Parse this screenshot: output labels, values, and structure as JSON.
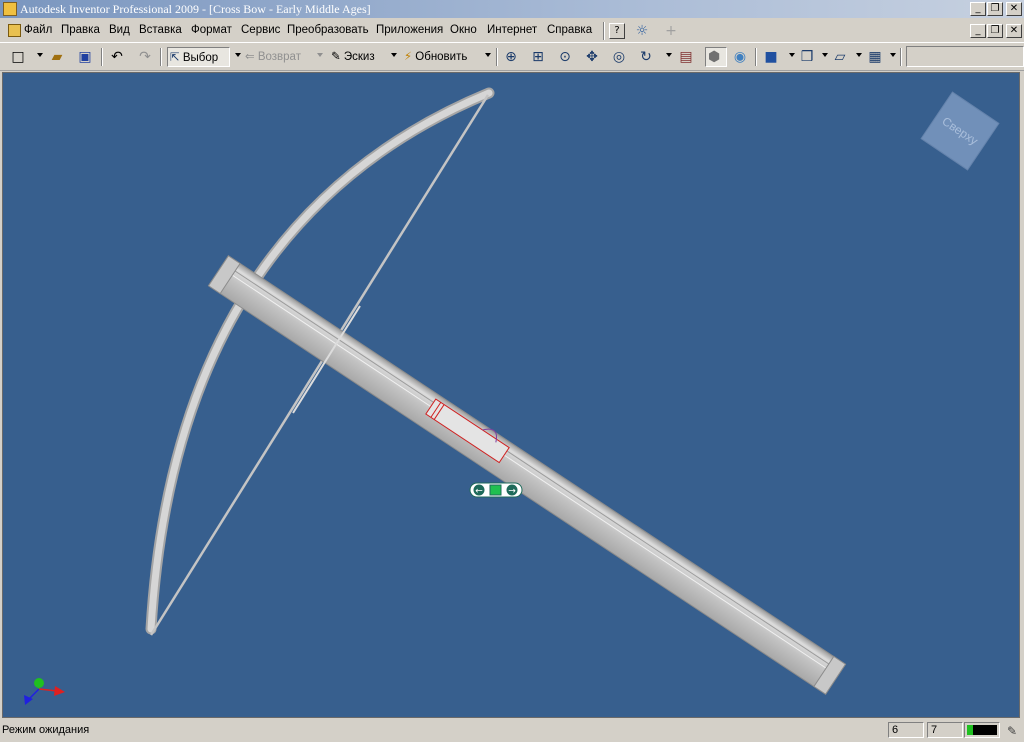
{
  "window": {
    "title": "Autodesk Inventor Professional 2009 - [Cross Bow - Early Middle Ages]",
    "minimize_glyph": "_",
    "restore_glyph": "❐",
    "close_glyph": "✕"
  },
  "menu": {
    "items": [
      {
        "label": "Файл"
      },
      {
        "label": "Правка"
      },
      {
        "label": "Вид"
      },
      {
        "label": "Вставка"
      },
      {
        "label": "Формат"
      },
      {
        "label": "Сервис"
      },
      {
        "label": "Преобразовать"
      },
      {
        "label": "Приложения"
      },
      {
        "label": "Окно"
      },
      {
        "label": "Интернет"
      },
      {
        "label": "Справка"
      }
    ],
    "help_glyph": "?"
  },
  "toolbar": {
    "select_label": "Выбор",
    "return_label": "Возврат",
    "sketch_label": "Эскиз",
    "update_label": "Обновить"
  },
  "viewcube": {
    "label": "Сверху"
  },
  "status": {
    "text": "Режим ожидания",
    "count_a": "6",
    "count_b": "7"
  },
  "colors": {
    "viewport_bg": "#375f8e",
    "model_gray": "#c8c8c8",
    "highlight_red": "#d02020",
    "triad_x": "#e02020",
    "triad_y": "#20c020",
    "triad_z": "#2020e0"
  }
}
